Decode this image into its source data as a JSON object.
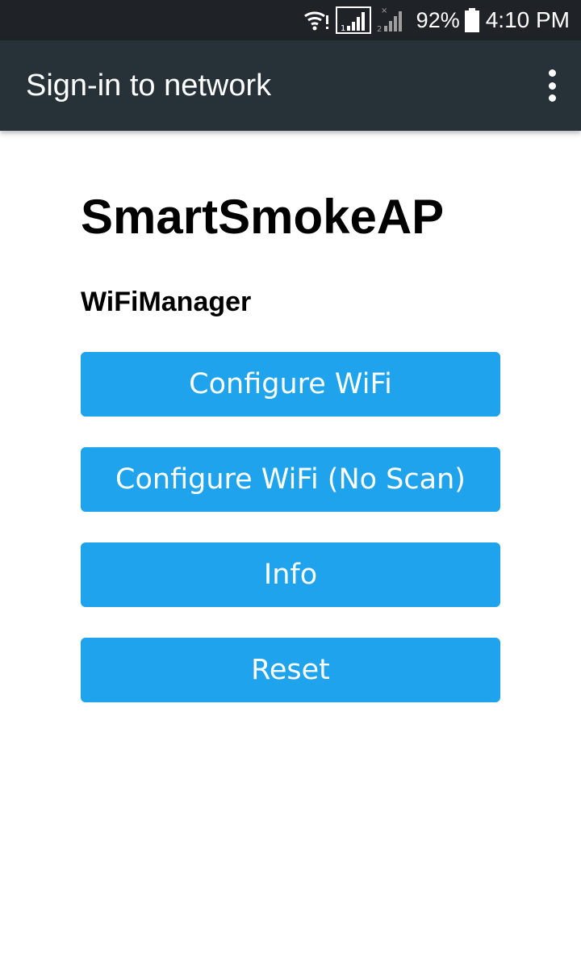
{
  "status_bar": {
    "battery_percent": "92%",
    "time": "4:10 PM",
    "sim1_label": "1",
    "sim2_label": "2",
    "icons": [
      "wifi-alert-icon",
      "sim1-signal-icon",
      "sim2-signal-off-icon",
      "battery-icon"
    ]
  },
  "app_bar": {
    "title": "Sign-in to network",
    "menu_icon": "overflow-menu-icon"
  },
  "page": {
    "heading": "SmartSmokeAP",
    "subheading": "WiFiManager"
  },
  "buttons": [
    {
      "label": "Configure WiFi"
    },
    {
      "label": "Configure WiFi (No Scan)"
    },
    {
      "label": "Info"
    },
    {
      "label": "Reset"
    }
  ],
  "colors": {
    "status_bar": "#1f2327",
    "app_bar": "#263238",
    "button": "#1fa3ec",
    "button_text": "#ffffff",
    "page_background": "#ffffff"
  }
}
